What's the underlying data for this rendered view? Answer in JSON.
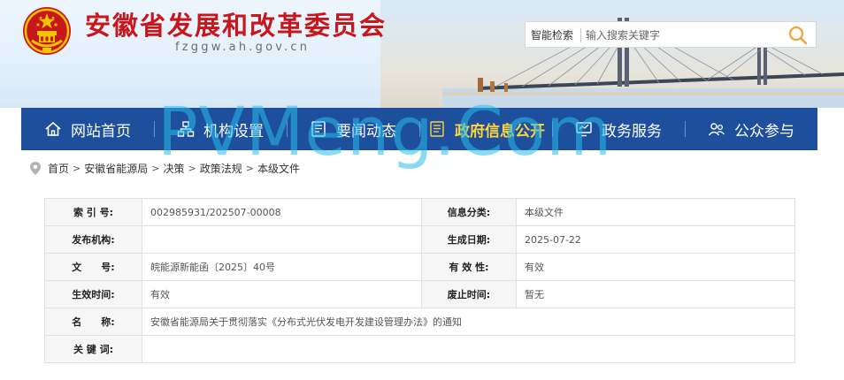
{
  "header": {
    "title": "安徽省发展和改革委员会",
    "domain": "fzggw.ah.gov.cn"
  },
  "search": {
    "label": "智能检索",
    "placeholder": "输入搜索关键字"
  },
  "nav": {
    "items": [
      {
        "label": "网站首页",
        "icon": "home-icon"
      },
      {
        "label": "机构设置",
        "icon": "org-chart-icon"
      },
      {
        "label": "要闻动态",
        "icon": "news-icon"
      },
      {
        "label": "政府信息公开",
        "icon": "document-icon",
        "active": true
      },
      {
        "label": "政务服务",
        "icon": "monitor-icon"
      },
      {
        "label": "公众参与",
        "icon": "people-icon"
      }
    ]
  },
  "breadcrumb": {
    "items": [
      "首页",
      "安徽省能源局",
      "决策",
      "政策法规",
      "本级文件"
    ]
  },
  "info": {
    "index_label": "索 引 号:",
    "index_value": "002985931/202507-00008",
    "category_label": "信息分类:",
    "category_value": "本级文件",
    "publisher_label": "发布机构:",
    "publisher_value": "",
    "date_label": "生成日期:",
    "date_value": "2025-07-22",
    "docno_label": "文　　号:",
    "docno_value": "皖能源新能函〔2025〕40号",
    "validity_label": "有 效 性:",
    "validity_value": "有效",
    "effective_label": "生效时间:",
    "effective_value": "有效",
    "repeal_label": "废止时间:",
    "repeal_value": "暂无",
    "name_label": "名　　称:",
    "name_value": "安徽省能源局关于贯彻落实《分布式光伏发电开发建设管理办法》的通知",
    "keywords_label": "关 键 词:",
    "keywords_value": ""
  },
  "watermark": "PVMeng.Com",
  "colors": {
    "nav_bg": "#1d4f9d",
    "nav_active": "#ffd33c",
    "title_red": "#c8161d",
    "watermark": "#28bee9"
  }
}
